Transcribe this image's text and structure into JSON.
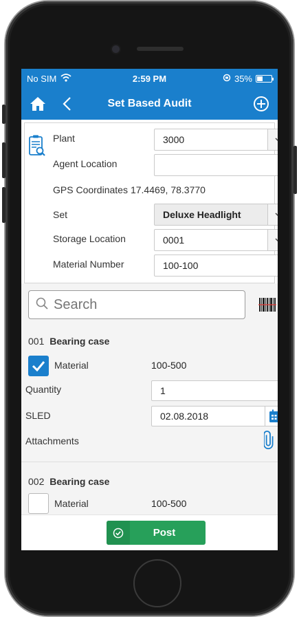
{
  "status": {
    "carrier": "No SIM",
    "time": "2:59 PM",
    "battery": "35%"
  },
  "header": {
    "title": "Set Based Audit",
    "icons": [
      "home-icon",
      "back-icon",
      "add-icon"
    ]
  },
  "form": {
    "plant": {
      "label": "Plant",
      "value": "3000"
    },
    "agent_location": {
      "label": "Agent Location",
      "value": ""
    },
    "gps": {
      "label": "GPS Coordinates",
      "value": "17.4469, 78.3770"
    },
    "set": {
      "label": "Set",
      "value": "Deluxe Headlight"
    },
    "storage_location": {
      "label": "Storage Location",
      "value": "0001"
    },
    "material_number": {
      "label": "Material Number",
      "value": "100-100"
    }
  },
  "search": {
    "placeholder": "Search"
  },
  "items": [
    {
      "num": "001",
      "name": "Bearing case",
      "checked": true,
      "material_label": "Material",
      "material_value": "100-500",
      "quantity_label": "Quantity",
      "quantity_value": "1",
      "sled_label": "SLED",
      "sled_value": "02.08.2018",
      "attachments_label": "Attachments"
    },
    {
      "num": "002",
      "name": "Bearing case",
      "checked": false,
      "material_label": "Material",
      "material_value": "100-500"
    }
  ],
  "footer": {
    "post_label": "Post"
  },
  "colors": {
    "primary": "#1a7fcc",
    "post": "#27a05a"
  }
}
